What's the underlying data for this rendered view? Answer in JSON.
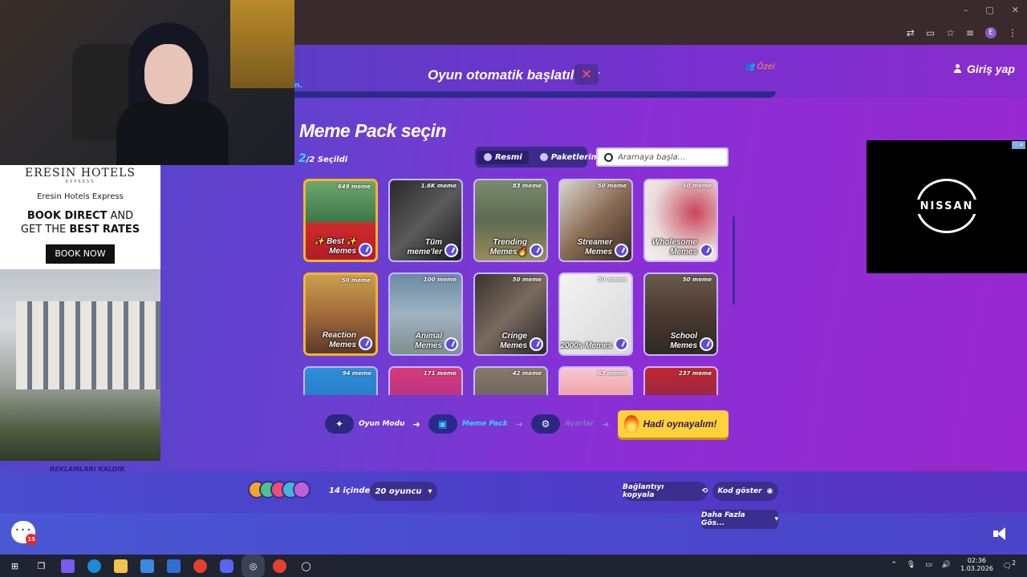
{
  "browser": {
    "window_controls": [
      "–",
      "▢",
      "✕"
    ],
    "profile_initial": "E"
  },
  "header": {
    "auto_start_text": "Oyun otomatik başlatılıyor",
    "cancel_symbol": "✕",
    "private_label": "Özel",
    "login_label": "Giriş yap",
    "cut_text": "n."
  },
  "pack_select": {
    "title": "Meme Pack seçin",
    "selected_current": "2",
    "selected_rest": "/2 Seçildi",
    "filters": [
      "Resmi",
      "Paketlerim"
    ],
    "search_placeholder": "Aramaya başla..."
  },
  "packs": [
    {
      "name": "✨ Best ✨ Memes",
      "count": "649 meme",
      "selected": true,
      "bg": "linear-gradient(180deg,#6fa66d 0%,#3d7a4a 50%,#d02a2a 55%,#b01e2a 100%)"
    },
    {
      "name": "Tüm meme'ler",
      "count": "1.6K meme",
      "selected": false,
      "bg": "linear-gradient(135deg,#2a2a2a,#5a5a5a 50%,#1a1a1a)"
    },
    {
      "name": "Trending Memes🔥",
      "count": "83 meme",
      "selected": false,
      "bg": "linear-gradient(180deg,#7b8a6a,#5e6b53 50%,#9a8c5b)"
    },
    {
      "name": "Streamer Memes",
      "count": "50 meme",
      "selected": false,
      "bg": "linear-gradient(135deg,#d9d6d1,#8a6d55 50%,#3a2a22)"
    },
    {
      "name": "Wholesome Memes",
      "count": "50 meme",
      "selected": false,
      "bg": "radial-gradient(circle at 70% 40%,#c9455a 0%,#e9dada 60%,#f5f1f1)"
    },
    {
      "name": "Reaction Memes",
      "count": "50 meme",
      "selected": true,
      "bg": "linear-gradient(180deg,#c9a04e,#a46b3a 50%,#5a3a2a)"
    },
    {
      "name": "Animal Memes",
      "count": "100 meme",
      "selected": false,
      "bg": "linear-gradient(180deg,#6b8aa3,#9fb3c2 50%,#7e8f8e)"
    },
    {
      "name": "Cringe Memes",
      "count": "50 meme",
      "selected": false,
      "bg": "linear-gradient(135deg,#3a3330,#7a6a5e 50%,#2a2626)"
    },
    {
      "name": "2000s Memes",
      "count": "50 meme",
      "selected": false,
      "bg": "linear-gradient(135deg,#f3f3f3,#d8d8d8)"
    },
    {
      "name": "School Memes",
      "count": "50 meme",
      "selected": false,
      "bg": "linear-gradient(180deg,#6a5a4e,#4a3a30 50%,#2e2824)"
    },
    {
      "name": "",
      "count": "94 meme",
      "selected": false,
      "bg": "linear-gradient(180deg,#2e8fd9,#1f5fa3)"
    },
    {
      "name": "",
      "count": "171 meme",
      "selected": false,
      "bg": "linear-gradient(180deg,#d93b7a,#7a2a8a)"
    },
    {
      "name": "",
      "count": "42 meme",
      "selected": false,
      "bg": "linear-gradient(180deg,#8a7a6a,#3a3a4a)"
    },
    {
      "name": "",
      "count": "63 meme",
      "selected": false,
      "bg": "linear-gradient(180deg,#f5c9d2,#e35a5a)"
    },
    {
      "name": "",
      "count": "237 meme",
      "selected": false,
      "bg": "linear-gradient(180deg,#c2272d,#4a2a6a)"
    }
  ],
  "steps": {
    "mode": "Oyun Modu",
    "pack": "Meme Pack",
    "settings": "Ayarlar",
    "play": "Hadi oynayalım!"
  },
  "footer": {
    "remove_ads": "REKLAMLARI KALDIR",
    "players_label": "14 içinden",
    "players_select": "20 oyuncu",
    "copy_link": "Bağlantıyı kopyala",
    "show_code": "Kod göster",
    "show_more": "Daha Fazla Gös...",
    "chat_badge": "15",
    "avatar_colors": [
      "#f5a623",
      "#4cc38a",
      "#e94e77",
      "#41b8d5",
      "#c060d8"
    ]
  },
  "ad_left": {
    "brand": "ERESIN HOTELS",
    "brand_sub": "EXPRESS",
    "name": "Eresin Hotels Express",
    "cta_line1_bold": "BOOK DIRECT",
    "cta_line1_rest": " AND",
    "cta_line2_rest": "GET THE ",
    "cta_line2_bold": "BEST RATES",
    "button": "BOOK NOW"
  },
  "ad_right": {
    "brand": "NISSAN"
  },
  "taskbar": {
    "time": "02:36",
    "date": "1.03.2026",
    "notif_count": "2"
  }
}
